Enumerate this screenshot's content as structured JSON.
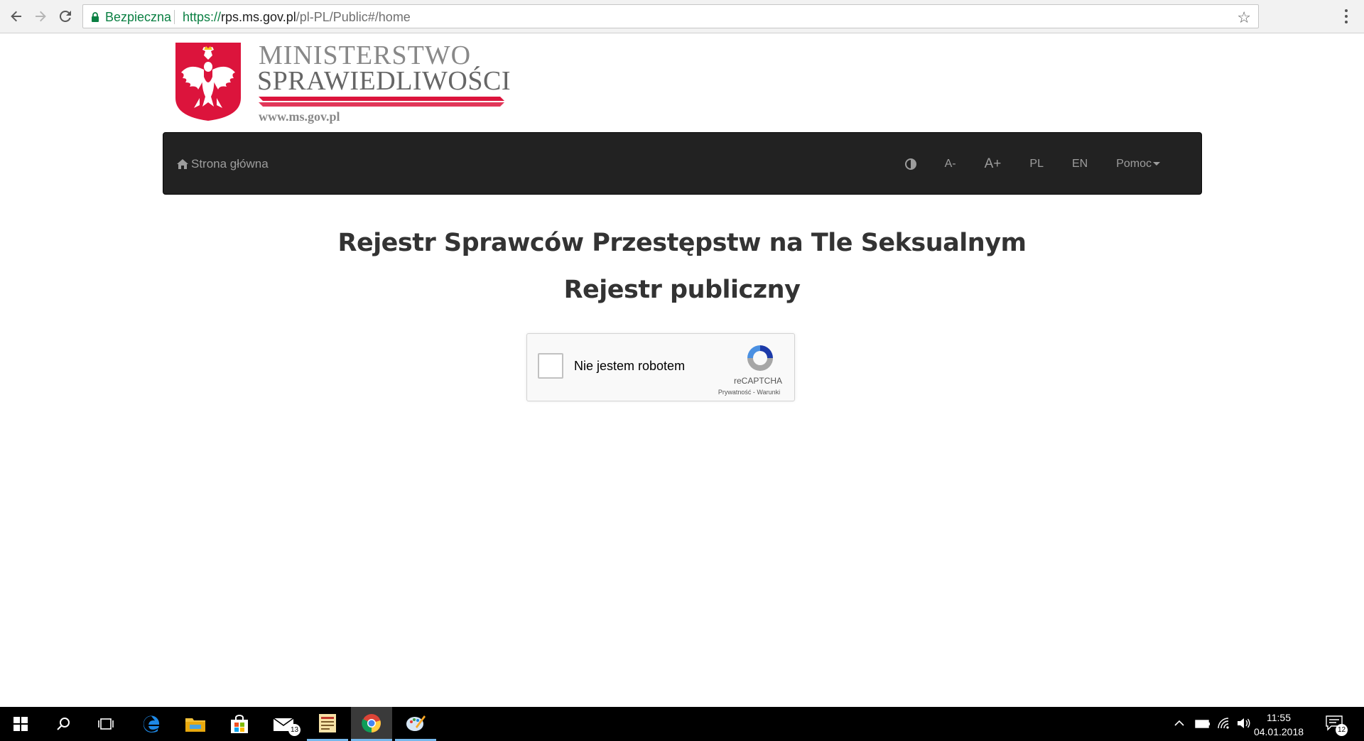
{
  "browser": {
    "secure_label": "Bezpieczna",
    "url_scheme": "https://",
    "url_host": "rps.ms.gov.pl",
    "url_path": "/pl-PL/Public#/home"
  },
  "logo": {
    "line1": "MINISTERSTWO",
    "line2": "SPRAWIEDLIWOŚCI",
    "website": "www.ms.gov.pl"
  },
  "navbar": {
    "home_label": "Strona główna",
    "contrast_icon": "contrast-icon",
    "font_smaller": "A-",
    "font_larger": "A+",
    "lang_pl": "PL",
    "lang_en": "EN",
    "help": "Pomoc"
  },
  "main": {
    "title": "Rejestr Sprawców Przestępstw na Tle Seksualnym",
    "subtitle": "Rejestr publiczny"
  },
  "recaptcha": {
    "label": "Nie jestem robotem",
    "brand": "reCAPTCHA",
    "terms": "Prywatność - Warunki"
  },
  "taskbar": {
    "mail_badge": "13",
    "time": "11:55",
    "date": "04.01.2018",
    "notification_badge": "12"
  },
  "colors": {
    "navbar_bg": "#222222",
    "secure_green": "#0b8043",
    "heading": "#333333",
    "emblem_red": "#dc143c"
  }
}
